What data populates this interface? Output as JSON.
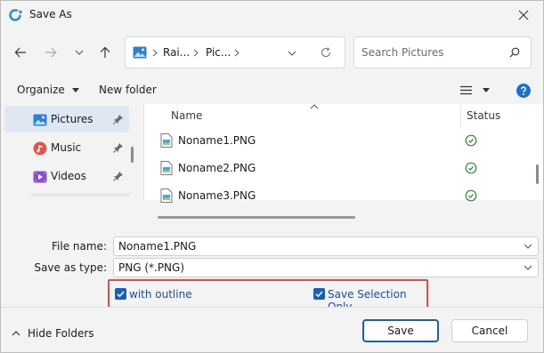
{
  "window": {
    "title": "Save As",
    "accent": "#1a5fb4"
  },
  "address": {
    "crumbs": [
      "Rai...",
      "Pic..."
    ]
  },
  "search": {
    "placeholder": "Search Pictures"
  },
  "toolbar": {
    "organize": "Organize",
    "new_folder": "New folder"
  },
  "sidebar": {
    "items": [
      {
        "label": "Pictures",
        "icon": "pictures-icon"
      },
      {
        "label": "Music",
        "icon": "music-icon"
      },
      {
        "label": "Videos",
        "icon": "videos-icon"
      }
    ]
  },
  "filelist": {
    "columns": {
      "name": "Name",
      "status": "Status"
    },
    "files": [
      {
        "name": "Noname1.PNG"
      },
      {
        "name": "Noname2.PNG"
      },
      {
        "name": "Noname3.PNG"
      }
    ]
  },
  "form": {
    "file_name_label": "File name:",
    "file_name_value": "Noname1.PNG",
    "save_type_label": "Save as type:",
    "save_type_value": "PNG (*.PNG)"
  },
  "options": {
    "with_outline": "with outline",
    "save_selection_only": "Save Selection Only",
    "highlight_color": "#e04b4b"
  },
  "footer": {
    "hide_folders": "Hide Folders",
    "save": "Save",
    "cancel": "Cancel"
  }
}
